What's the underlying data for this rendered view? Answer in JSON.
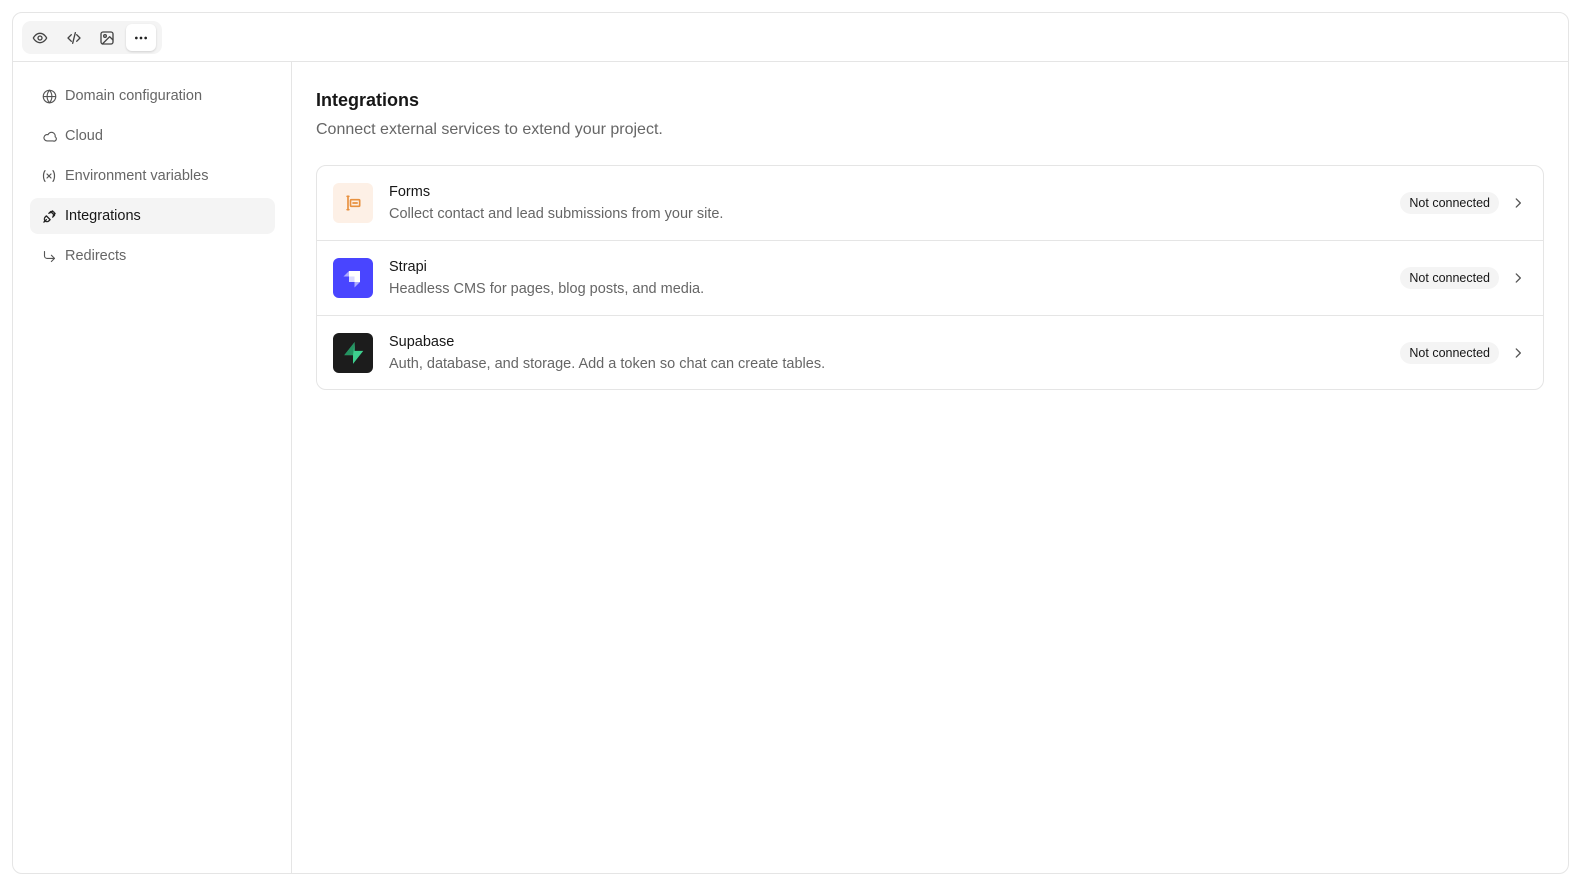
{
  "toolbar": {
    "buttons": [
      {
        "icon": "eye-icon",
        "label": "Preview"
      },
      {
        "icon": "code-icon",
        "label": "Code"
      },
      {
        "icon": "image-icon",
        "label": "Design"
      },
      {
        "icon": "more-horizontal-icon",
        "label": "More",
        "active": true
      }
    ]
  },
  "sidebar": {
    "items": [
      {
        "label": "Domain configuration",
        "icon": "globe-icon"
      },
      {
        "label": "Cloud",
        "icon": "cloud-icon"
      },
      {
        "label": "Environment variables",
        "icon": "variable-icon"
      },
      {
        "label": "Integrations",
        "icon": "plug-icon",
        "active": true
      },
      {
        "label": "Redirects",
        "icon": "redirect-arrow-icon"
      }
    ]
  },
  "main": {
    "title": "Integrations",
    "subtitle": "Connect external services to extend your project.",
    "integrations": [
      {
        "name": "Forms",
        "description": "Collect contact and lead submissions from your site.",
        "status": "Not connected",
        "icon": "forms-icon",
        "color": "#fdf0e6"
      },
      {
        "name": "Strapi",
        "description": "Headless CMS for pages, blog posts, and media.",
        "status": "Not connected",
        "icon": "strapi-logo-icon",
        "color": "#4945ff"
      },
      {
        "name": "Supabase",
        "description": "Auth, database, and storage. Add a token so chat can create tables.",
        "status": "Not connected",
        "icon": "supabase-logo-icon",
        "color": "#1c1c1c"
      }
    ]
  }
}
